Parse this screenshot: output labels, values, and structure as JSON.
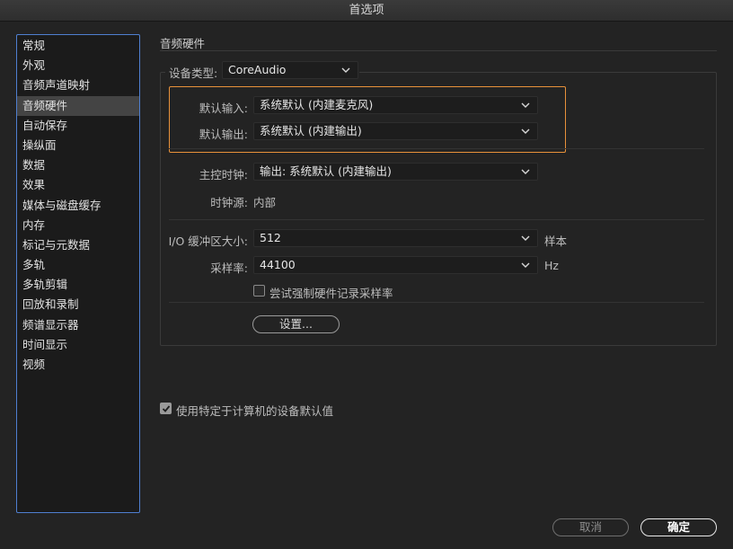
{
  "window": {
    "title": "首选项"
  },
  "sidebar": {
    "items": [
      {
        "label": "常规"
      },
      {
        "label": "外观"
      },
      {
        "label": "音频声道映射"
      },
      {
        "label": "音频硬件"
      },
      {
        "label": "自动保存"
      },
      {
        "label": "操纵面"
      },
      {
        "label": "数据"
      },
      {
        "label": "效果"
      },
      {
        "label": "媒体与磁盘缓存"
      },
      {
        "label": "内存"
      },
      {
        "label": "标记与元数据"
      },
      {
        "label": "多轨"
      },
      {
        "label": "多轨剪辑"
      },
      {
        "label": "回放和录制"
      },
      {
        "label": "频谱显示器"
      },
      {
        "label": "时间显示"
      },
      {
        "label": "视频"
      }
    ],
    "selected": "音频硬件"
  },
  "main": {
    "section_title": "音频硬件",
    "device_type": {
      "label": "设备类型:",
      "value": "CoreAudio"
    },
    "default_input": {
      "label": "默认输入:",
      "value": "系统默认 (内建麦克风)"
    },
    "default_output": {
      "label": "默认输出:",
      "value": "系统默认 (内建输出)"
    },
    "master_clock": {
      "label": "主控时钟:",
      "value": "输出: 系统默认 (内建输出)"
    },
    "clock_source": {
      "label": "时钟源:",
      "value": "内部"
    },
    "io_buffer": {
      "label": "I/O 缓冲区大小:",
      "value": "512",
      "unit": "样本"
    },
    "sample_rate": {
      "label": "采样率:",
      "value": "44100",
      "unit": "Hz"
    },
    "force_sample_rate": {
      "label": "尝试强制硬件记录采样率",
      "checked": false
    },
    "settings_button": "设置...",
    "machine_defaults": {
      "label": "使用特定于计算机的设备默认值",
      "checked": true
    }
  },
  "footer": {
    "cancel_label": "取消",
    "ok_label": "确定"
  },
  "colors": {
    "background": "#232323",
    "sidebar_border": "#4f7fd0",
    "highlight_border": "#e8913a",
    "selected_item": "#444444"
  }
}
